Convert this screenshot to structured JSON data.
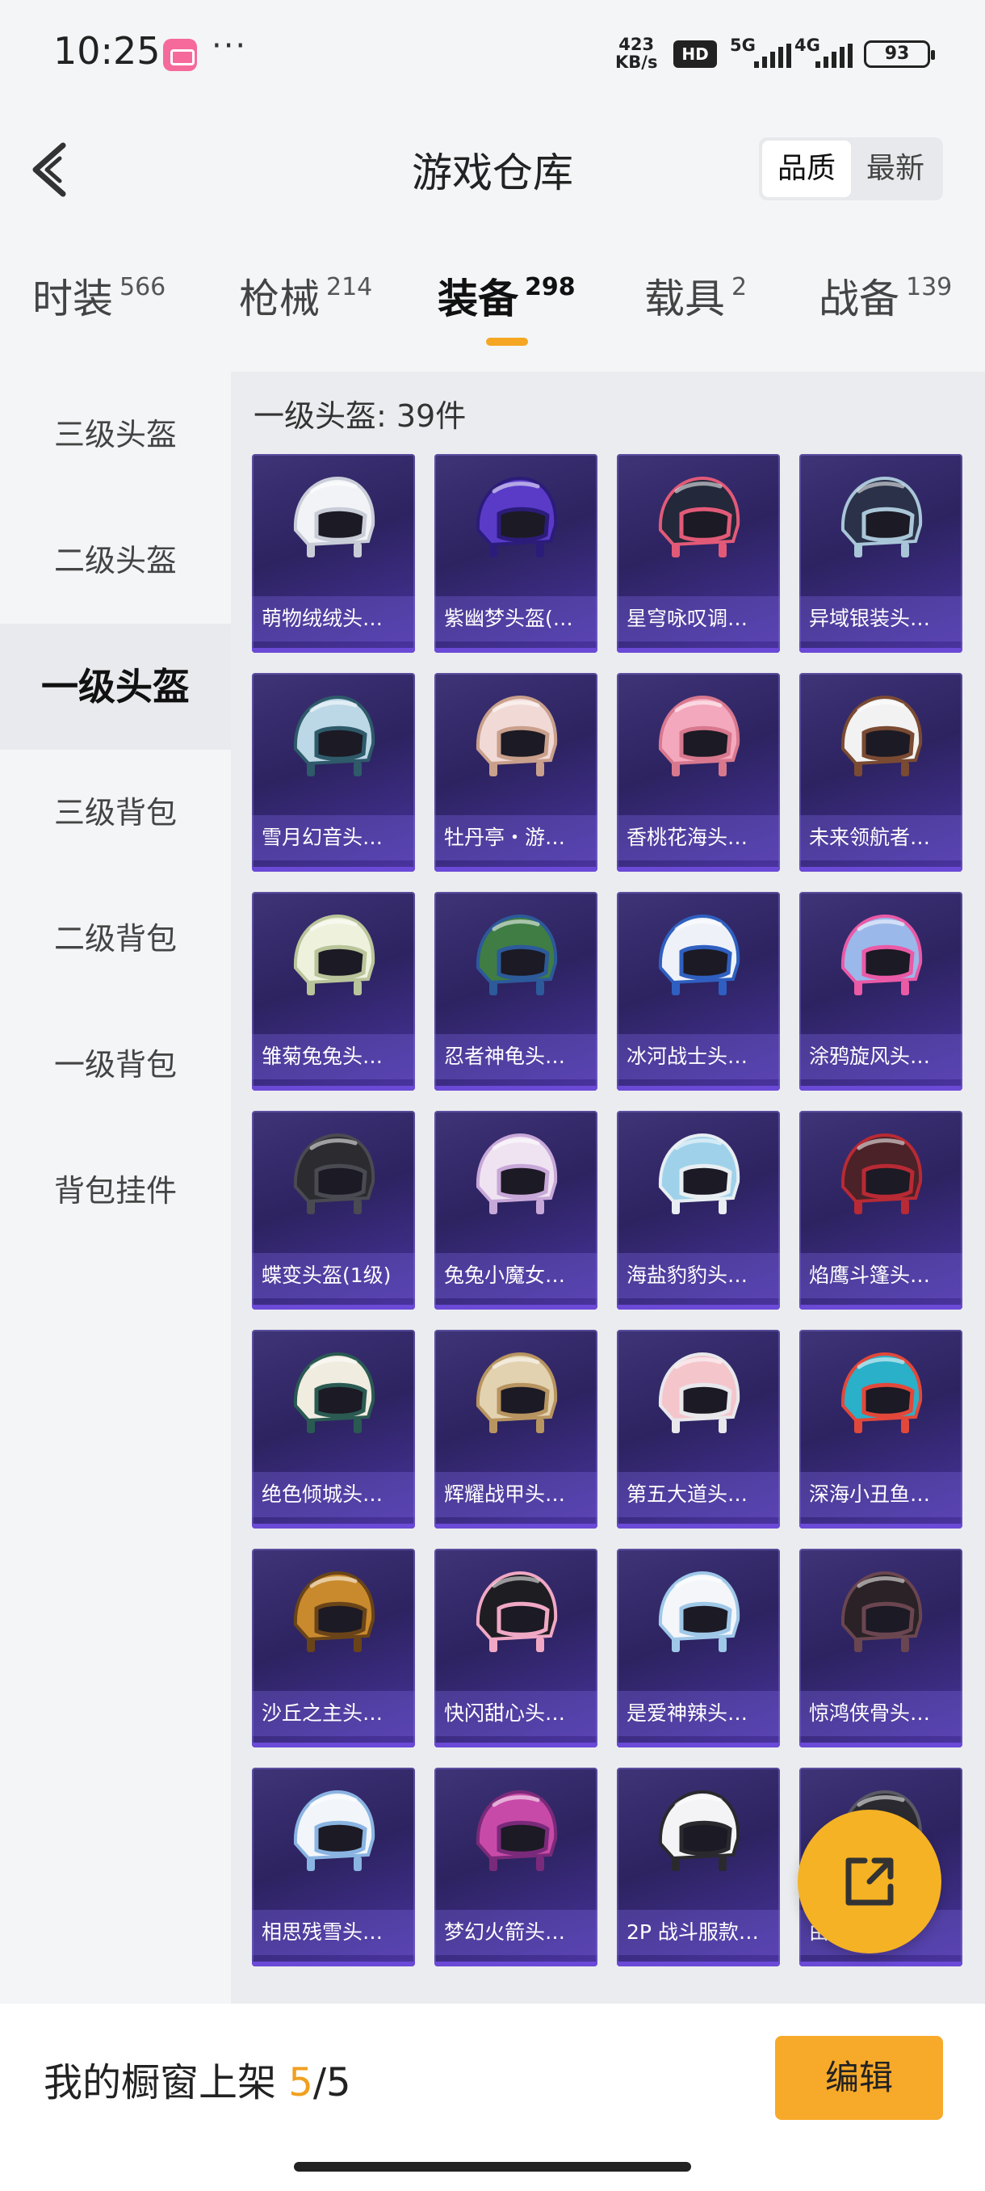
{
  "status_bar": {
    "time": "10:25",
    "more": "···",
    "net_speed_value": "423",
    "net_speed_unit": "KB/s",
    "hd": "HD",
    "sim1": "5G",
    "sim2": "4G",
    "battery": "93"
  },
  "header": {
    "title": "游戏仓库",
    "sort_options": [
      "品质",
      "最新"
    ],
    "sort_active": "品质"
  },
  "tabs": [
    {
      "label": "时装",
      "count": "566"
    },
    {
      "label": "枪械",
      "count": "214"
    },
    {
      "label": "装备",
      "count": "298"
    },
    {
      "label": "载具",
      "count": "2"
    },
    {
      "label": "战备",
      "count": "139"
    }
  ],
  "active_tab": "装备",
  "side_menu": [
    "三级头盔",
    "二级头盔",
    "一级头盔",
    "三级背包",
    "二级背包",
    "一级背包",
    "背包挂件"
  ],
  "side_menu_active": "一级头盔",
  "section_heading": "一级头盔: 39件",
  "items": [
    {
      "label": "萌物绒绒头…",
      "colors": [
        "#f2f3f6",
        "#c9cdd8"
      ]
    },
    {
      "label": "紫幽梦头盔(…",
      "colors": [
        "#5a3bc8",
        "#2c1c7a"
      ]
    },
    {
      "label": "星穹咏叹调…",
      "colors": [
        "#23283a",
        "#e25a78"
      ]
    },
    {
      "label": "异域银装头…",
      "colors": [
        "#2a3148",
        "#a9c6d8"
      ]
    },
    {
      "label": "雪月幻音头…",
      "colors": [
        "#bcd7e6",
        "#2e5a6a"
      ]
    },
    {
      "label": "牡丹亭・游…",
      "colors": [
        "#f1d9d6",
        "#c9a08c"
      ]
    },
    {
      "label": "香桃花海头…",
      "colors": [
        "#f4a8bd",
        "#d8788e"
      ]
    },
    {
      "label": "未来领航者…",
      "colors": [
        "#f2f2f2",
        "#7a4a32"
      ]
    },
    {
      "label": "雏菊兔兔头…",
      "colors": [
        "#eef2dc",
        "#b9c49a"
      ]
    },
    {
      "label": "忍者神龟头…",
      "colors": [
        "#3f7d44",
        "#2c5a9a"
      ]
    },
    {
      "label": "冰河战士头…",
      "colors": [
        "#eef2f8",
        "#2f5fc0"
      ]
    },
    {
      "label": "涂鸦旋风头…",
      "colors": [
        "#9bb8ea",
        "#ea5aa6"
      ]
    },
    {
      "label": "蝶变头盔(1级)",
      "colors": [
        "#2b2b30",
        "#4a4a52"
      ]
    },
    {
      "label": "兔兔小魔女…",
      "colors": [
        "#efe3f2",
        "#c8a8d8"
      ]
    },
    {
      "label": "海盐豹豹头…",
      "colors": [
        "#9fd2ea",
        "#e8eef2"
      ]
    },
    {
      "label": "焰鹰斗篷头…",
      "colors": [
        "#4a2228",
        "#b82a34"
      ]
    },
    {
      "label": "绝色倾城头…",
      "colors": [
        "#f0ece0",
        "#2a5a52"
      ]
    },
    {
      "label": "辉耀战甲头…",
      "colors": [
        "#e2d2b0",
        "#b89460"
      ]
    },
    {
      "label": "第五大道头…",
      "colors": [
        "#f4c6cc",
        "#e8e8ec"
      ]
    },
    {
      "label": "深海小丑鱼…",
      "colors": [
        "#2ab0c8",
        "#e2483a"
      ]
    },
    {
      "label": "沙丘之主头…",
      "colors": [
        "#c98a2e",
        "#6a4418"
      ]
    },
    {
      "label": "快闪甜心头…",
      "colors": [
        "#1e1e22",
        "#f0a8c4"
      ]
    },
    {
      "label": "是爱神辣头…",
      "colors": [
        "#f4f6fa",
        "#9fc8e8"
      ]
    },
    {
      "label": "惊鸿侠骨头…",
      "colors": [
        "#2a2226",
        "#6a4650"
      ]
    },
    {
      "label": "相思残雪头…",
      "colors": [
        "#f2f6fa",
        "#8ab4e2"
      ]
    },
    {
      "label": "梦幻火箭头…",
      "colors": [
        "#c84aa8",
        "#7a2a7a"
      ]
    },
    {
      "label": "2P 战斗服款…",
      "colors": [
        "#f4f4f6",
        "#2a2a2e"
      ]
    },
    {
      "label": "由…头…",
      "colors": [
        "#2a2a30",
        "#5a5a66"
      ]
    }
  ],
  "showcase": {
    "prefix": "我的橱窗上架 ",
    "current": "5",
    "separator": "/",
    "total": "5"
  },
  "edit_label": "编辑",
  "colors": {
    "accent": "#f5a623",
    "card_bg": "#2d2361",
    "edit_button": "#f7a92a"
  }
}
